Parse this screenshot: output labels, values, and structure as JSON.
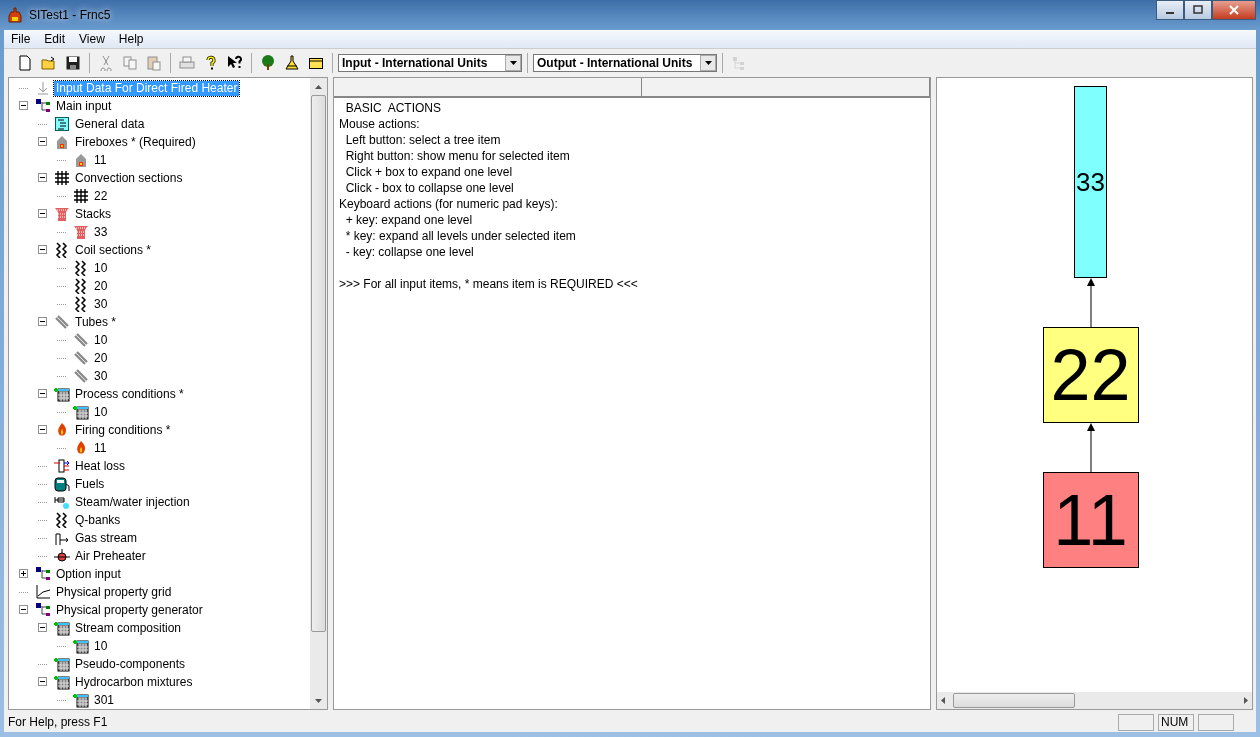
{
  "window": {
    "title": "SITest1 - Frnc5"
  },
  "menu": [
    "File",
    "Edit",
    "View",
    "Help"
  ],
  "toolbar": [
    {
      "kind": "new",
      "disabled": false
    },
    {
      "kind": "open",
      "disabled": false
    },
    {
      "kind": "save",
      "disabled": false
    },
    {
      "kind": "sep"
    },
    {
      "kind": "cut",
      "disabled": true
    },
    {
      "kind": "copy",
      "disabled": true
    },
    {
      "kind": "paste",
      "disabled": true
    },
    {
      "kind": "sep"
    },
    {
      "kind": "print",
      "disabled": true
    },
    {
      "kind": "help",
      "disabled": false
    },
    {
      "kind": "whatsthis",
      "disabled": false
    },
    {
      "kind": "sep"
    },
    {
      "kind": "tree",
      "disabled": false
    },
    {
      "kind": "flask",
      "disabled": false
    },
    {
      "kind": "folder",
      "disabled": false
    },
    {
      "kind": "sep"
    },
    {
      "kind": "combo",
      "value": "Input - International Units"
    },
    {
      "kind": "sep"
    },
    {
      "kind": "combo",
      "value": "Output - International Units"
    },
    {
      "kind": "sep"
    },
    {
      "kind": "layout",
      "disabled": true
    }
  ],
  "tree": [
    {
      "label": "Input Data For Direct Fired Heater",
      "kind": "root",
      "selected": true
    },
    {
      "label": "Main input",
      "kind": "group",
      "selected": false,
      "expanded": true,
      "children": [
        {
          "label": "General data",
          "kind": "doc",
          "selected": false
        },
        {
          "label": "Fireboxes * (Required)",
          "kind": "house",
          "selected": false,
          "expanded": true,
          "children": [
            {
              "label": "11",
              "kind": "house",
              "selected": false
            }
          ]
        },
        {
          "label": "Convection sections",
          "kind": "grid",
          "selected": false,
          "expanded": true,
          "children": [
            {
              "label": "22",
              "kind": "grid",
              "selected": false
            }
          ]
        },
        {
          "label": "Stacks",
          "kind": "stack",
          "selected": false,
          "expanded": true,
          "children": [
            {
              "label": "33",
              "kind": "stack",
              "selected": false
            }
          ]
        },
        {
          "label": "Coil sections *",
          "kind": "coil",
          "selected": false,
          "expanded": true,
          "children": [
            {
              "label": "10",
              "kind": "coil",
              "selected": false
            },
            {
              "label": "20",
              "kind": "coil",
              "selected": false
            },
            {
              "label": "30",
              "kind": "coil",
              "selected": false
            }
          ]
        },
        {
          "label": "Tubes *",
          "kind": "tube",
          "selected": false,
          "expanded": true,
          "children": [
            {
              "label": "10",
              "kind": "tube",
              "selected": false
            },
            {
              "label": "20",
              "kind": "tube",
              "selected": false
            },
            {
              "label": "30",
              "kind": "tube",
              "selected": false
            }
          ]
        },
        {
          "label": "Process conditions *",
          "kind": "table",
          "selected": false,
          "expanded": true,
          "children": [
            {
              "label": "10",
              "kind": "table",
              "selected": false
            }
          ]
        },
        {
          "label": "Firing conditions *",
          "kind": "flame",
          "selected": false,
          "expanded": true,
          "children": [
            {
              "label": "11",
              "kind": "flame",
              "selected": false
            }
          ]
        },
        {
          "label": "Heat loss",
          "kind": "heat",
          "selected": false
        },
        {
          "label": "Fuels",
          "kind": "fuel",
          "selected": false
        },
        {
          "label": "Steam/water injection",
          "kind": "steam",
          "selected": false
        },
        {
          "label": "Q-banks",
          "kind": "coil",
          "selected": false
        },
        {
          "label": "Gas stream",
          "kind": "gas",
          "selected": false
        },
        {
          "label": "Air Preheater",
          "kind": "air",
          "selected": false
        }
      ]
    },
    {
      "label": "Option input",
      "kind": "group",
      "selected": false,
      "expanded": false
    },
    {
      "label": "Physical property grid",
      "kind": "graph",
      "selected": false
    },
    {
      "label": "Physical property generator",
      "kind": "group",
      "selected": false,
      "expanded": true,
      "children": [
        {
          "label": "Stream composition",
          "kind": "table",
          "selected": false,
          "expanded": true,
          "children": [
            {
              "label": "10",
              "kind": "table",
              "selected": false
            }
          ]
        },
        {
          "label": "Pseudo-components",
          "kind": "table",
          "selected": false
        },
        {
          "label": "Hydrocarbon mixtures",
          "kind": "table",
          "selected": false,
          "expanded": true,
          "children": [
            {
              "label": "301",
              "kind": "table",
              "selected": false
            }
          ]
        }
      ]
    }
  ],
  "help_text": [
    "  BASIC  ACTIONS",
    "Mouse actions:",
    "  Left button: select a tree item",
    "  Right button: show menu for selected item",
    "  Click + box to expand one level",
    "  Click - box to collapse one level",
    "Keyboard actions (for numeric pad keys):",
    "  + key: expand one level",
    "  * key: expand all levels under selected item",
    "  - key: collapse one level"
  ],
  "help_note": ">>> For all input items, * means item is REQUIRED <<<",
  "diagram": [
    {
      "label": "33",
      "kind": "stack",
      "color": "#80ffff"
    },
    {
      "label": "22",
      "kind": "convection",
      "color": "#ffff80"
    },
    {
      "label": "11",
      "kind": "firebox",
      "color": "#ff8080"
    }
  ],
  "status_bar": {
    "text": "For Help, press F1",
    "indicators": [
      "NUM"
    ]
  }
}
